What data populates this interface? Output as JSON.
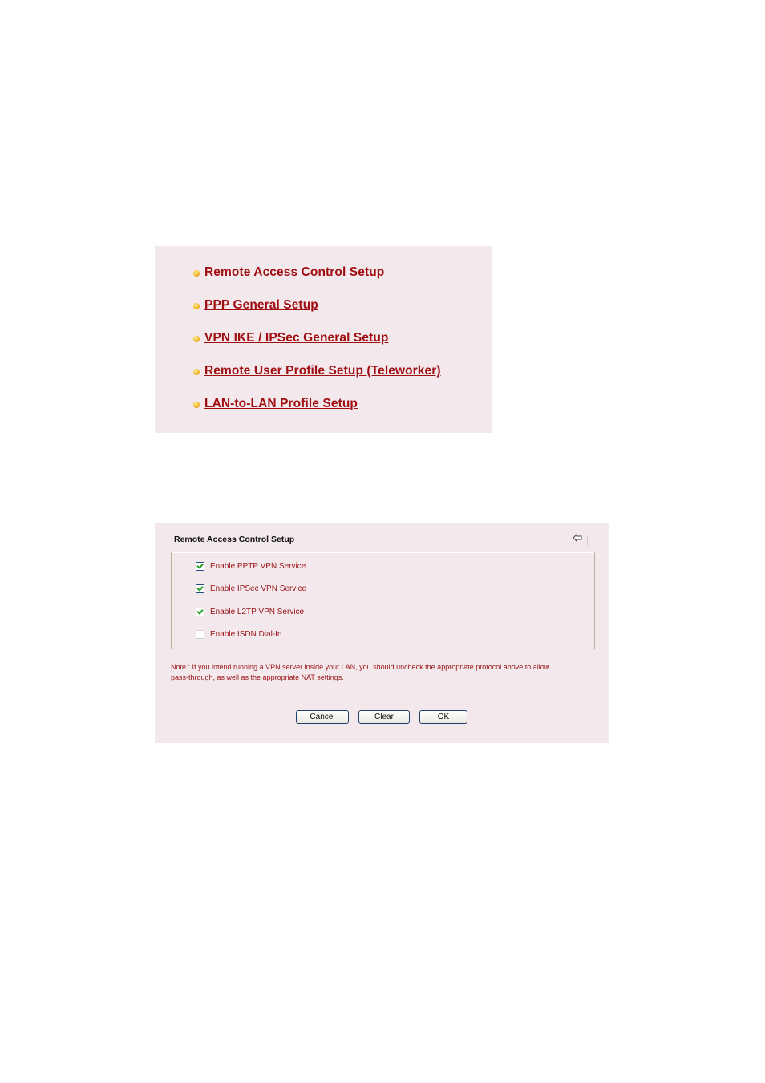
{
  "menu": {
    "items": [
      {
        "label": "Remote Access Control Setup"
      },
      {
        "label": "PPP General Setup"
      },
      {
        "label": "VPN IKE / IPSec General Setup"
      },
      {
        "label": "Remote User Profile Setup (Teleworker)"
      },
      {
        "label": "LAN-to-LAN Profile Setup"
      }
    ],
    "bullet_icon": "orange-dot-bullet-icon"
  },
  "setup": {
    "title": "Remote Access Control Setup",
    "back_icon": "back-arrow-icon",
    "options": [
      {
        "label": "Enable PPTP VPN Service",
        "checked": true
      },
      {
        "label": "Enable IPSec VPN Service",
        "checked": true
      },
      {
        "label": "Enable L2TP VPN Service",
        "checked": true
      },
      {
        "label": "Enable ISDN Dial-In",
        "checked": false
      }
    ],
    "note_line1": "Note : If you intend running a VPN server inside your LAN, you should uncheck the appropriate protocol above to allow",
    "note_line2": "pass-through, as well as the appropriate NAT settings.",
    "buttons": {
      "cancel": "Cancel",
      "clear": "Clear",
      "ok": "OK"
    }
  },
  "colors": {
    "panel_bg": "#f3e9ec",
    "link": "#a00e12",
    "label_text": "#9a1418"
  }
}
